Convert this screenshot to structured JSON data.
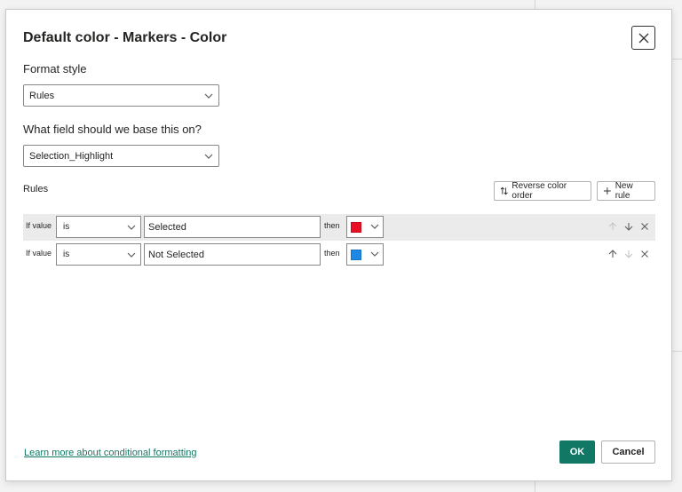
{
  "dialog": {
    "title": "Default color - Markers - Color",
    "close_icon": "close-icon"
  },
  "format_style": {
    "label": "Format style",
    "value": "Rules"
  },
  "base_field": {
    "label": "What field should we base this on?",
    "value": "Selection_Highlight"
  },
  "rules": {
    "label": "Rules",
    "reverse_button": "Reverse color order",
    "new_rule_button": "New rule",
    "items": [
      {
        "if_label": "If value",
        "condition": "is",
        "value": "Selected",
        "then_label": "then",
        "color": "#e81123"
      },
      {
        "if_label": "If value",
        "condition": "is",
        "value": "Not Selected",
        "then_label": "then",
        "color": "#1e88e5"
      }
    ]
  },
  "footer": {
    "learn_more_link": "Learn more about conditional formatting",
    "ok_button": "OK",
    "cancel_button": "Cancel"
  },
  "colors": {
    "accent": "#117865",
    "highlight_row": "#ebebeb"
  }
}
